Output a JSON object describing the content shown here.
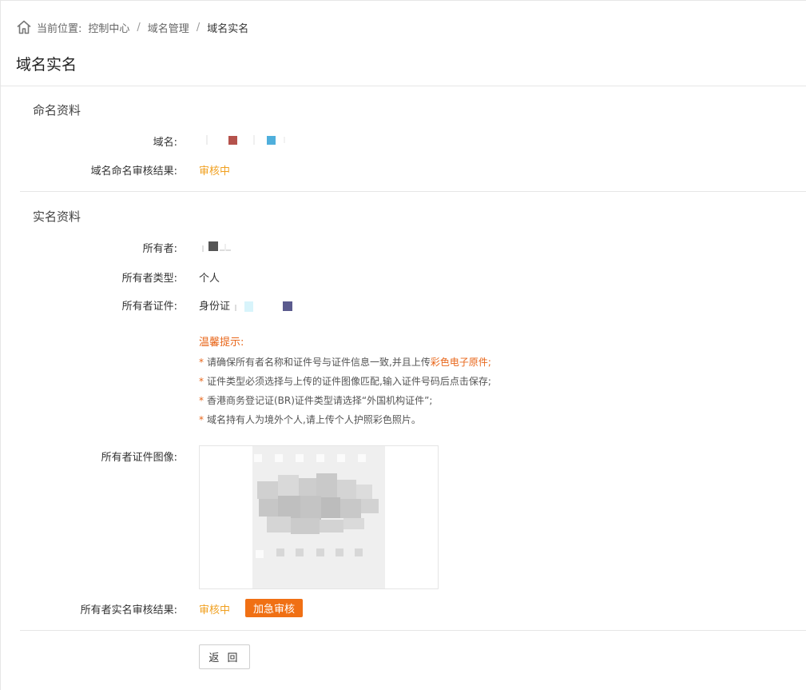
{
  "breadcrumb": {
    "prefix": "当前位置:",
    "items": [
      "控制中心",
      "域名管理",
      "域名实名"
    ],
    "separator": "/"
  },
  "page_title": "域名实名",
  "naming_section": {
    "title": "命名资料",
    "domain_label": "域名:",
    "review_label": "域名命名审核结果:",
    "review_status": "审核中"
  },
  "realname_section": {
    "title": "实名资料",
    "owner_label": "所有者:",
    "owner_type_label": "所有者类型:",
    "owner_type_value": "个人",
    "owner_cert_label": "所有者证件:",
    "owner_cert_value": "身份证",
    "tips": {
      "title": "温馨提示:",
      "line1_a": "请确保所有者名称和证件号与证件信息一致,并且上传",
      "line1_b": "彩色电子原件;",
      "line2": "证件类型必须选择与上传的证件图像匹配,输入证件号码后点击保存;",
      "line3": "香港商务登记证(BR)证件类型请选择“外国机构证件”;",
      "line4": "域名持有人为境外个人,请上传个人护照彩色照片。"
    },
    "cert_image_label": "所有者证件图像:",
    "review_label": "所有者实名审核结果:",
    "review_status": "审核中",
    "urgent_button": "加急审核"
  },
  "back_button": "返 回",
  "icons": {
    "home": "home-icon"
  },
  "colors": {
    "status": "#f0a020",
    "accent": "#f07014",
    "tip_highlight": "#e8661a"
  }
}
